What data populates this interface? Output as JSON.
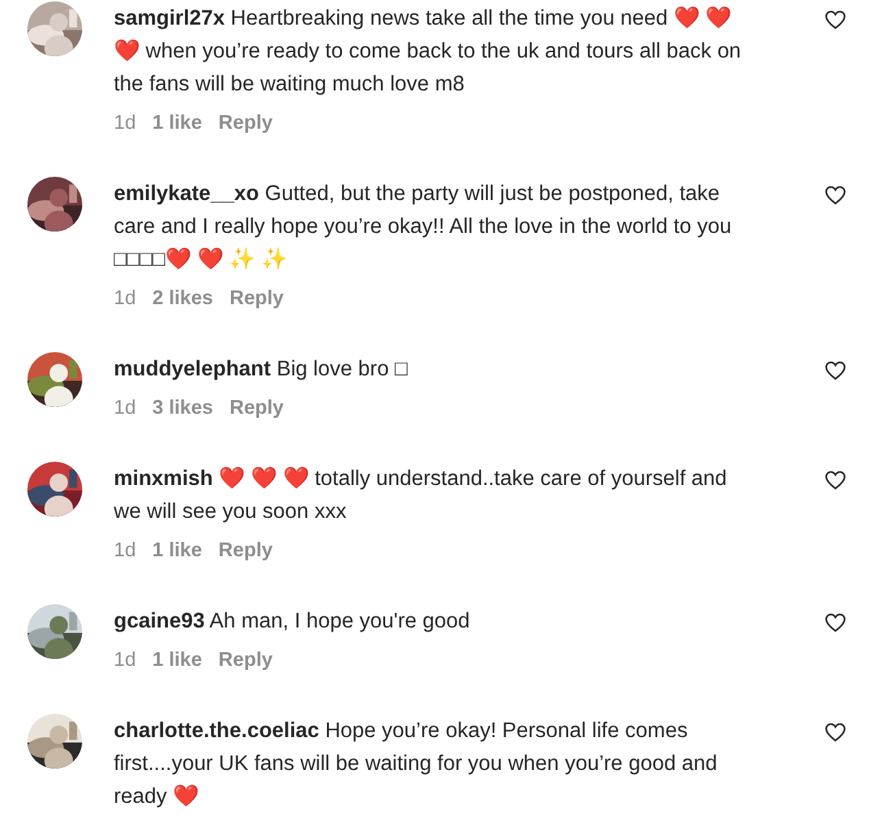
{
  "comments": [
    {
      "username": "samgirl27x",
      "text": "Heartbreaking news take all the time you need ❤️ ❤️ ❤️ when you’re ready to come back to the uk and tours all back on the fans will be waiting much love m8",
      "time": "1d",
      "likes": "1 like",
      "reply": "Reply",
      "liked": false
    },
    {
      "username": "emilykate__xo",
      "text": "Gutted, but the party will just be postponed, take care and I really hope you’re okay!! All the love in the world to you □□□□❤️ ❤️ ✨ ✨",
      "time": "1d",
      "likes": "2 likes",
      "reply": "Reply",
      "liked": false
    },
    {
      "username": "muddyelephant",
      "text": "Big love bro □",
      "time": "1d",
      "likes": "3 likes",
      "reply": "Reply",
      "liked": false
    },
    {
      "username": "minxmish",
      "text": "❤️ ❤️ ❤️ totally understand..take care of yourself and we will see you soon xxx",
      "time": "1d",
      "likes": "1 like",
      "reply": "Reply",
      "liked": false
    },
    {
      "username": "gcaine93",
      "text": "Ah man, I hope you're good",
      "time": "1d",
      "likes": "1 like",
      "reply": "Reply",
      "liked": false
    },
    {
      "username": "charlotte.the.coeliac",
      "text": "Hope you’re okay! Personal life comes first....your UK fans will be waiting for you when you’re good and ready ❤️",
      "liked": false
    }
  ]
}
